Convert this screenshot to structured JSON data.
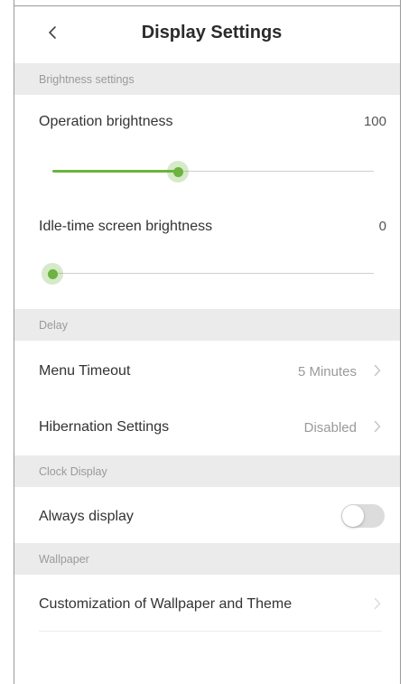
{
  "header": {
    "title": "Display Settings",
    "back_icon": "chevron-left-icon"
  },
  "sections": {
    "brightness": "Brightness settings",
    "delay": "Delay",
    "clock": "Clock Display",
    "wallpaper": "Wallpaper"
  },
  "brightness": {
    "operation_label": "Operation brightness",
    "operation_value": "100",
    "operation_level": 0.39,
    "idle_label": "Idle-time screen brightness",
    "idle_value": "0",
    "idle_level": 0.0
  },
  "delay": {
    "menu_timeout_label": "Menu Timeout",
    "menu_timeout_value": "5 Minutes",
    "hibernation_label": "Hibernation Settings",
    "hibernation_value": "Disabled"
  },
  "clock": {
    "always_display_label": "Always display",
    "always_display_on": false
  },
  "wallpaper": {
    "customization_label": "Customization of Wallpaper and Theme"
  },
  "colors": {
    "accent": "#6cb33f",
    "section_bg": "#ebebeb",
    "secondary_text": "#9a9a9a"
  }
}
